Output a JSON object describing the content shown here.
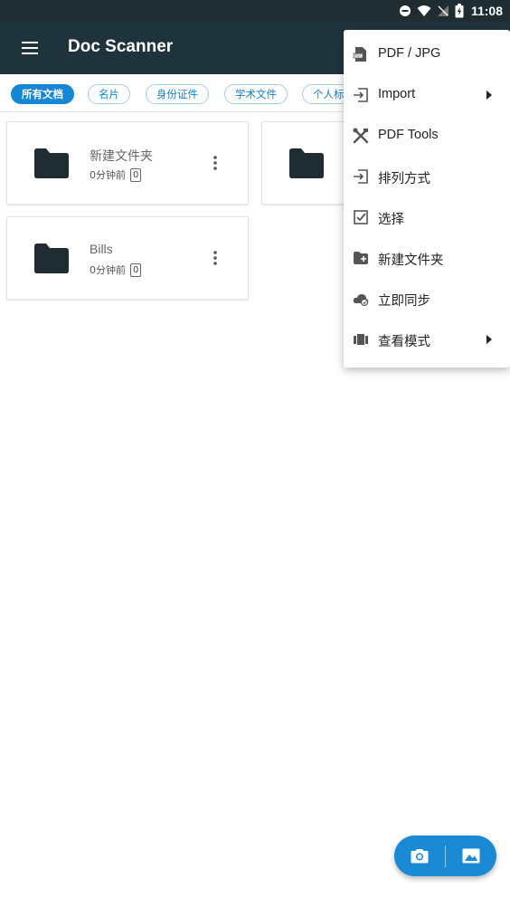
{
  "status_bar": {
    "time": "11:08",
    "icons": [
      "do-not-disturb-icon",
      "wifi-icon",
      "no-signal-icon",
      "battery-charging-icon"
    ]
  },
  "app_bar": {
    "title": "Doc Scanner",
    "menu_icon": "hamburger-menu-icon"
  },
  "chips": [
    {
      "label": "所有文档",
      "active": true
    },
    {
      "label": "名片",
      "active": false
    },
    {
      "label": "身份证件",
      "active": false
    },
    {
      "label": "学术文件",
      "active": false
    },
    {
      "label": "个人标签",
      "active": false
    }
  ],
  "folders": [
    {
      "name": "新建文件夹",
      "time": "0分钟前",
      "count": "0"
    },
    {
      "name": "",
      "time": "",
      "count": ""
    },
    {
      "name": "Bills",
      "time": "0分钟前",
      "count": "0"
    }
  ],
  "overflow_menu": {
    "items": [
      {
        "label": "PDF / JPG",
        "icon": "pdf-file-icon",
        "has_submenu": false
      },
      {
        "label": "Import",
        "icon": "import-icon",
        "has_submenu": true
      },
      {
        "label": "PDF Tools",
        "icon": "tools-icon",
        "has_submenu": false
      },
      {
        "label": "排列方式",
        "icon": "sort-icon",
        "has_submenu": false
      },
      {
        "label": "选择",
        "icon": "checkbox-icon",
        "has_submenu": false
      },
      {
        "label": "新建文件夹",
        "icon": "new-folder-icon",
        "has_submenu": false
      },
      {
        "label": "立即同步",
        "icon": "cloud-sync-icon",
        "has_submenu": false
      },
      {
        "label": "查看模式",
        "icon": "view-mode-icon",
        "has_submenu": true
      }
    ]
  },
  "fab": {
    "camera_icon": "camera-icon",
    "gallery_icon": "image-gallery-icon"
  },
  "colors": {
    "app_bar": "#1f333d",
    "accent": "#1a8ad4",
    "folder": "#1f2d33"
  }
}
